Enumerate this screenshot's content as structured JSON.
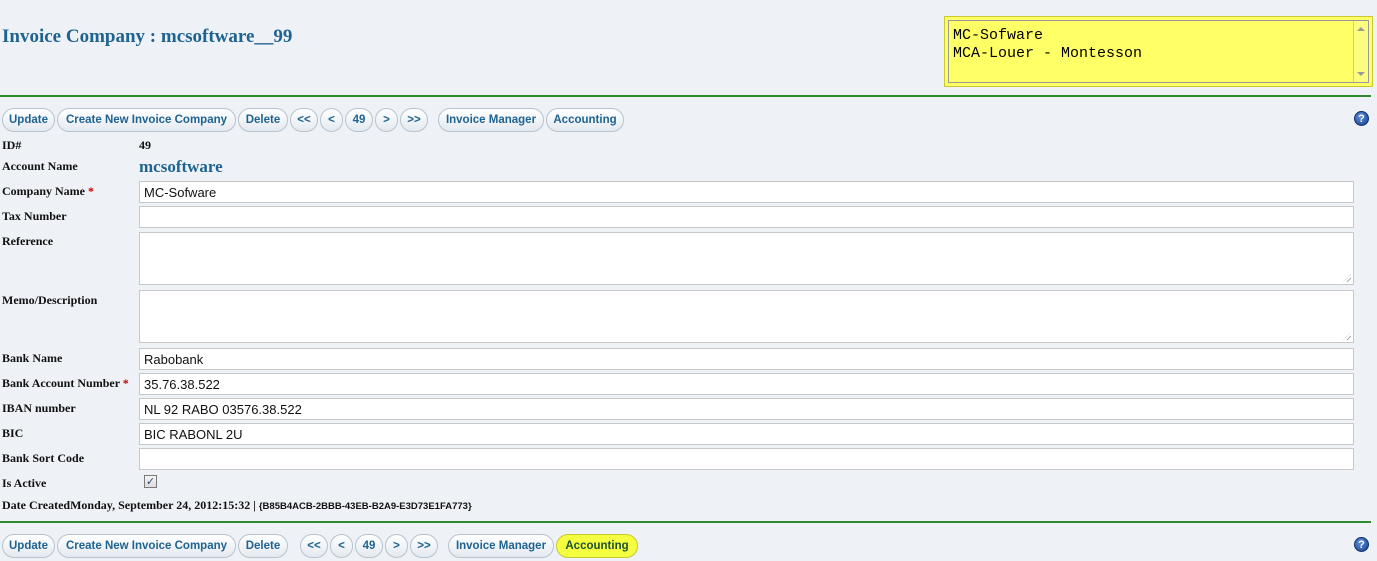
{
  "header": {
    "title": "Invoice Company : mcsoftware__99",
    "summary_line1": "MC-Sofware",
    "summary_line2": "MCA-Louer - Montesson"
  },
  "toolbar": {
    "update": "Update",
    "create": "Create New Invoice Company",
    "delete": "Delete",
    "first": "<<",
    "prev": "<",
    "page": "49",
    "next": ">",
    "last": ">>",
    "invoice_manager": "Invoice Manager",
    "accounting": "Accounting",
    "help": "?"
  },
  "form": {
    "id_label": "ID#",
    "id_value": "49",
    "account_label": "Account Name",
    "account_value": "mcsoftware",
    "company_label": "Company Name",
    "company_value": "MC-Sofware",
    "tax_label": "Tax Number",
    "tax_value": "",
    "reference_label": "Reference",
    "memo_label": "Memo/Description",
    "bank_label": "Bank Name",
    "bank_value": "Rabobank",
    "account_number_label": "Bank Account Number",
    "account_number_value": "35.76.38.522",
    "iban_label": "IBAN number",
    "iban_value": "NL 92 RABO 03576.38.522",
    "bic_label": "BIC",
    "bic_value": "BIC RABONL 2U",
    "sort_label": "Bank Sort Code",
    "sort_value": "",
    "active_label": "Is Active",
    "active_checked": true,
    "required_mark": "*"
  },
  "footer": {
    "created_label": "Date Created",
    "created_value": "Monday, September 24, 2012:15:32",
    "separator": " | ",
    "guid": "{B85B4ACB-2BBB-43EB-B2A9-E3D73E1FA773}"
  },
  "colors": {
    "accent": "#1f6391",
    "rule": "#2f8a2f",
    "highlight": "#ffff66"
  }
}
